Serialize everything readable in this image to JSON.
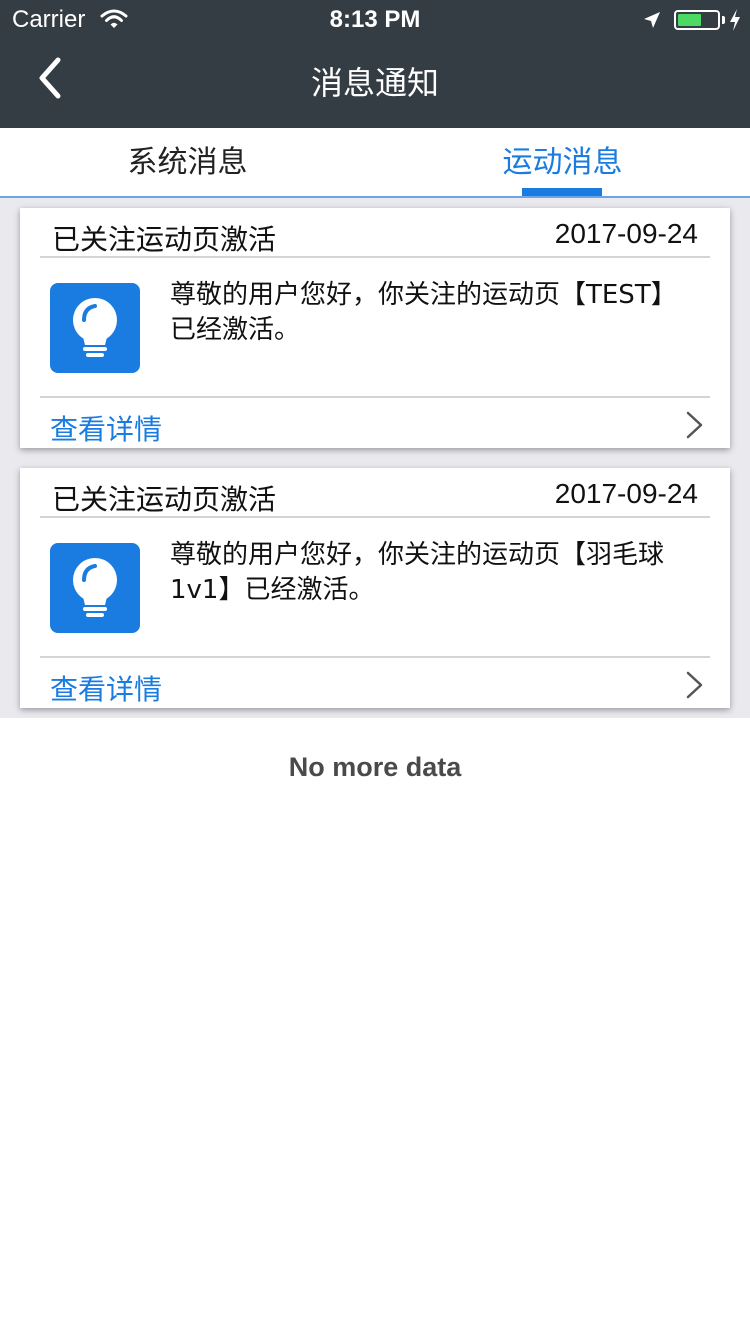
{
  "status_bar": {
    "carrier": "Carrier",
    "time": "8:13 PM",
    "battery_color": "#4cd964",
    "battery_level": 0.6
  },
  "nav": {
    "title": "消息通知",
    "back_icon": "chevron-left-icon"
  },
  "tabs": [
    {
      "label": "系统消息",
      "active": false
    },
    {
      "label": "运动消息",
      "active": true
    }
  ],
  "colors": {
    "accent": "#1a7be0",
    "header_bg": "#343c44"
  },
  "cards": [
    {
      "title": "已关注运动页激活",
      "date": "2017-09-24",
      "icon": "lightbulb-icon",
      "body": "尊敬的用户您好，你关注的运动页【TEST】已经激活。",
      "link": "查看详情"
    },
    {
      "title": "已关注运动页激活",
      "date": "2017-09-24",
      "icon": "lightbulb-icon",
      "body": "尊敬的用户您好，你关注的运动页【羽毛球 1v1】已经激活。",
      "link": "查看详情"
    }
  ],
  "footer": {
    "no_more": "No more data"
  }
}
